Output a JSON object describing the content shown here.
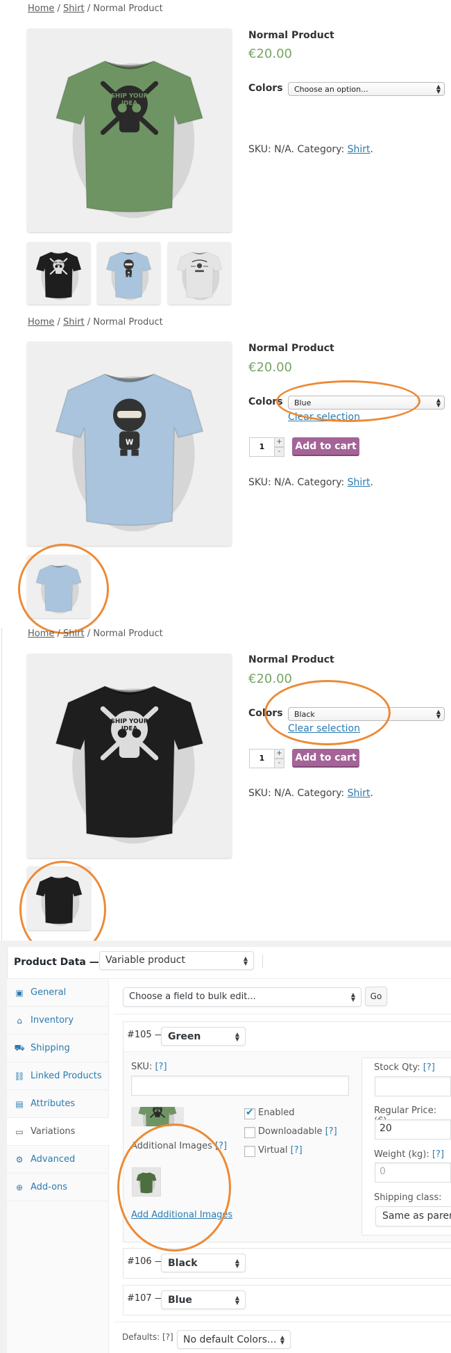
{
  "storefront_views": [
    {
      "breadcrumb": {
        "home": "Home",
        "sep1": " / ",
        "category": "Shirt",
        "sep2": " / ",
        "current": "Normal Product"
      },
      "product_title": "Normal Product",
      "price": "€20.00",
      "attribute_label": "Colors",
      "selected_option": "Choose an option...",
      "sku_text": "SKU: N/A. Category: ",
      "category_link": "Shirt",
      "period": ".",
      "main_image_color": "#6f9463",
      "main_print": "skull",
      "thumbnails": [
        {
          "alt": "Black shirt",
          "color": "#1e1e1e",
          "print": "skull"
        },
        {
          "alt": "Blue shirt",
          "color": "#a9c4dc",
          "print": "ninja"
        },
        {
          "alt": "White shirt",
          "color": "#e4e4e4",
          "print": "badge"
        }
      ]
    },
    {
      "breadcrumb": {
        "home": "Home",
        "sep1": " / ",
        "category": "Shirt",
        "sep2": " / ",
        "current": "Normal Product"
      },
      "product_title": "Normal Product",
      "price": "€20.00",
      "attribute_label": "Colors",
      "selected_option": "Blue",
      "clear_selection": "Clear selection",
      "quantity": "1",
      "qty_plus": "+",
      "qty_minus": "-",
      "add_to_cart": "Add to cart",
      "sku_text": "SKU: N/A. Category: ",
      "category_link": "Shirt",
      "period": ".",
      "main_image_color": "#a9c4dc",
      "main_print": "ninja",
      "thumbnails": [
        {
          "alt": "Blue shirt back",
          "color": "#a9c4dc",
          "print": "none"
        }
      ]
    },
    {
      "breadcrumb": {
        "home": "Home",
        "sep1": " / ",
        "category": "Shirt",
        "sep2": " / ",
        "current": "Normal Product"
      },
      "product_title": "Normal Product",
      "price": "€20.00",
      "attribute_label": "Colors",
      "selected_option": "Black",
      "clear_selection": "Clear selection",
      "quantity": "1",
      "qty_plus": "+",
      "qty_minus": "-",
      "add_to_cart": "Add to cart",
      "sku_text": "SKU: N/A. Category: ",
      "category_link": "Shirt",
      "period": ".",
      "main_image_color": "#1e1e1e",
      "main_print": "skull",
      "thumbnails": [
        {
          "alt": "Black shirt back",
          "color": "#1e1e1e",
          "print": "none"
        }
      ]
    }
  ],
  "print_text": {
    "line1": "SHIP YOUR",
    "line2": "IDEA",
    "ninja_letter": "W"
  },
  "admin": {
    "product_data_label": "Product Data —",
    "product_type": "Variable product",
    "tabs": [
      {
        "label": "General",
        "icon": "general-icon",
        "glyph": "▣"
      },
      {
        "label": "Inventory",
        "icon": "inventory-icon",
        "glyph": "⌂"
      },
      {
        "label": "Shipping",
        "icon": "shipping-icon",
        "glyph": "⛟"
      },
      {
        "label": "Linked Products",
        "icon": "link-icon",
        "glyph": "⛓"
      },
      {
        "label": "Attributes",
        "icon": "attributes-icon",
        "glyph": "▤"
      },
      {
        "label": "Variations",
        "icon": "variations-icon",
        "glyph": "▭",
        "active": true
      },
      {
        "label": "Advanced",
        "icon": "gear-icon",
        "glyph": "⚙"
      },
      {
        "label": "Add-ons",
        "icon": "plus-circle-icon",
        "glyph": "⊕"
      }
    ],
    "bulk_edit_placeholder": "Choose a field to bulk edit...",
    "go_button": "Go",
    "variations": [
      {
        "id": "#105 —",
        "value": "Green",
        "expanded": true,
        "sku_label": "SKU:",
        "help": "[?]",
        "sku_value": "",
        "image_color": "#6f9463",
        "enabled_label": "Enabled",
        "enabled": true,
        "downloadable_label": "Downloadable",
        "downloadable": false,
        "virtual_label": "Virtual",
        "virtual": false,
        "additional_images_label": "Additional Images",
        "additional_image_color": "#4d6e3f",
        "add_additional_images": "Add Additional Images",
        "stock_qty_label": "Stock Qty:",
        "stock_qty_value": "",
        "regular_price_label": "Regular Price: (€)",
        "regular_price_value": "20",
        "weight_label": "Weight (kg):",
        "weight_placeholder": "0",
        "shipping_class_label": "Shipping class:",
        "shipping_class_value": "Same as parent"
      },
      {
        "id": "#106 —",
        "value": "Black",
        "expanded": false
      },
      {
        "id": "#107 —",
        "value": "Blue",
        "expanded": false
      }
    ],
    "defaults_label": "Defaults:",
    "defaults_help": "[?]",
    "defaults_value": "No default Colors..."
  },
  "colors": {
    "price_green": "#77a464",
    "cart_purple": "#a46497",
    "link_blue": "#2a7bb0",
    "highlight_orange": "#ec8a35"
  }
}
